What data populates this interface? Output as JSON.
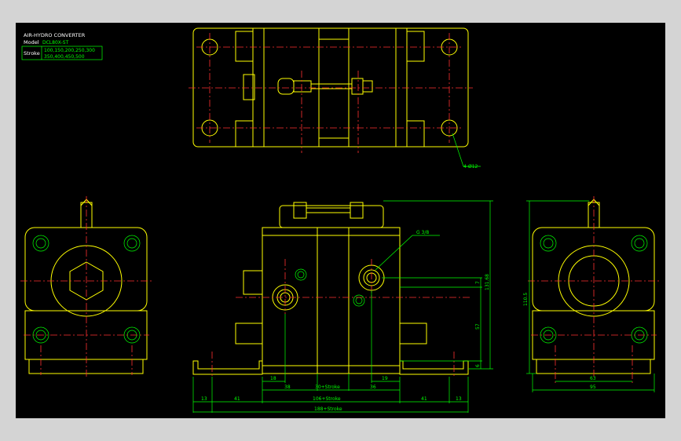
{
  "title_block": {
    "title": "AIR-HYDRO CONVERTER",
    "model_label": "Model",
    "model_value": "DCL80X-ST",
    "stroke_label": "Stroke",
    "stroke_line1": "100,150,200,250,300",
    "stroke_line2": "350,400,450,500"
  },
  "callouts": {
    "holes": "4-Ø12",
    "port": "G 3/8"
  },
  "dims_bottom": {
    "d13a": "13",
    "d41a": "41",
    "d18": "18",
    "d38": "38",
    "d30s": "30+Stroke",
    "d19": "19",
    "d36": "36",
    "d41b": "41",
    "d13b": "13",
    "d106s": "106+Stroke",
    "d188s": "188+Stroke"
  },
  "dims_right": {
    "d7": "7",
    "d131": "131.68",
    "d57": "57",
    "d6": "6"
  },
  "dims_side": {
    "d110": "110.5",
    "d63": "63",
    "d95": "95"
  },
  "colors": {
    "background": "#000000",
    "outline": "#ffff00",
    "centerline": "#ff3030",
    "dimension": "#00ff00",
    "text": "#ffffff"
  }
}
